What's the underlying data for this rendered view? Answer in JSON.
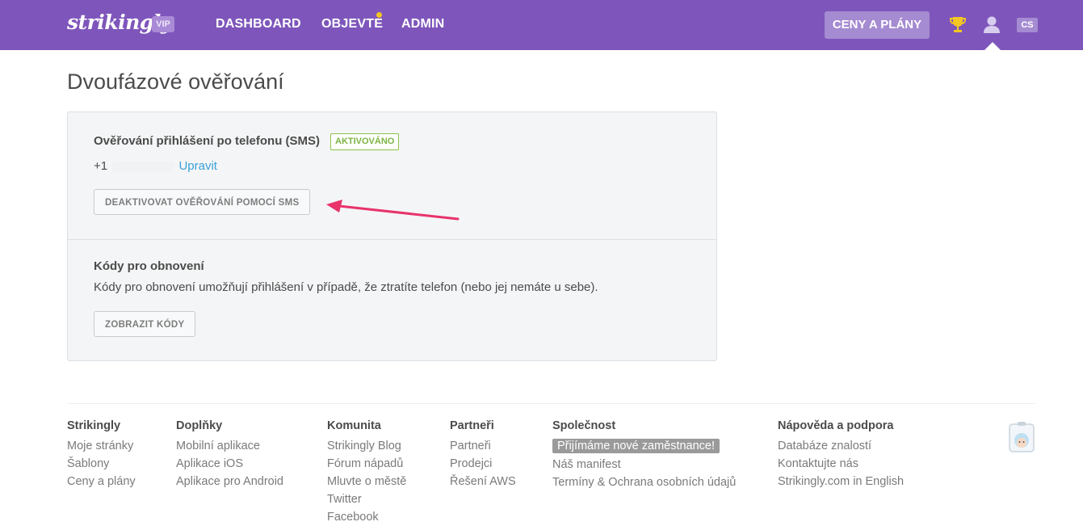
{
  "brand": {
    "logo": "strikingly",
    "badge": "VIP"
  },
  "nav": {
    "items": [
      {
        "label": "DASHBOARD"
      },
      {
        "label": "OBJEVTE"
      },
      {
        "label": "ADMIN"
      }
    ],
    "pricing_label": "CENY A PLÁNY",
    "language": "CS"
  },
  "page": {
    "title": "Dvoufázové ověřování"
  },
  "sms": {
    "heading": "Ověřování přihlášení po telefonu (SMS)",
    "status": "AKTIVOVÁNO",
    "phone_prefix": "+1",
    "edit_label": "Upravit",
    "deactivate_label": "DEAKTIVOVAT OVĚŘOVÁNÍ POMOCÍ SMS"
  },
  "recovery": {
    "heading": "Kódy pro obnovení",
    "description": "Kódy pro obnovení umožňují přihlášení v případě, že ztratíte telefon (nebo jej nemáte u sebe).",
    "show_label": "ZOBRAZIT KÓDY"
  },
  "footer": {
    "columns": [
      {
        "heading": "Strikingly",
        "links": [
          "Moje stránky",
          "Šablony",
          "Ceny a plány"
        ]
      },
      {
        "heading": "Doplňky",
        "links": [
          "Mobilní aplikace",
          "Aplikace iOS",
          "Aplikace pro Android"
        ]
      },
      {
        "heading": "Komunita",
        "links": [
          "Strikingly Blog",
          "Fórum nápadů",
          "Mluvte o městě",
          "Twitter",
          "Facebook"
        ]
      },
      {
        "heading": "Partneři",
        "links": [
          "Partneři",
          "Prodejci",
          "Řešení AWS"
        ]
      },
      {
        "heading": "Společnost",
        "links": [
          "Přijímáme nové zaměstnance!",
          "Náš manifest",
          "Termíny & Ochrana osobních údajů"
        ]
      },
      {
        "heading": "Nápověda a podpora",
        "links": [
          "Databáze znalostí",
          "Kontaktujte nás",
          "Strikingly.com in English"
        ]
      }
    ]
  },
  "colors": {
    "header_bg": "#7e56bb",
    "accent_link": "#3aa2d9",
    "status_green": "#7cb342",
    "annotation_arrow": "#e8336b"
  },
  "icons": [
    "trophy-icon",
    "user-icon",
    "helper-mascot-icon"
  ]
}
